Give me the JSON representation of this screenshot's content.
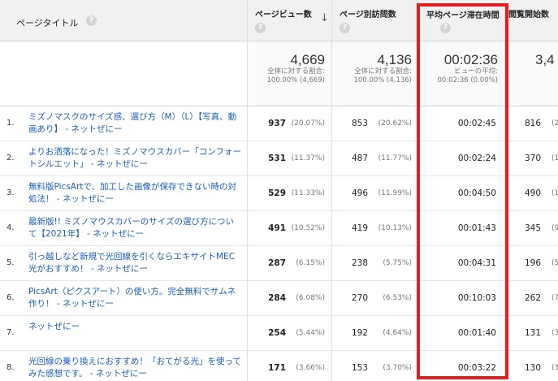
{
  "columns": {
    "title": "ページタイトル",
    "pageviews": "ページビュー数",
    "unique_pageviews": "ページ別訪問数",
    "avg_time": "平均ページ滞在時間",
    "entrances": "閲覧開始数",
    "help_glyph": "?",
    "sort_glyph": "↓"
  },
  "totals": {
    "pageviews": "4,669",
    "pageviews_sub": "全体に対する割合: 100.00% (4,669)",
    "unique_pageviews": "4,136",
    "unique_pageviews_sub": "全体に対する割合: 100.00% (4,136)",
    "avg_time": "00:02:36",
    "avg_time_sub": "ビューの平均: 00:02:36 (0.00%)",
    "entrances": "3,4"
  },
  "rows": [
    {
      "num": "1.",
      "title": "ミズノマスクのサイズ感、選び方（M）（L）【写真、動画あり】 - ネットぜにー",
      "pv": "937",
      "pv_pct": "(20.07%)",
      "upv": "853",
      "upv_pct": "(20.62%)",
      "avg": "00:02:45",
      "ent": "816",
      "ent_pct": "(23"
    },
    {
      "num": "2.",
      "title": "よりお洒落になった！ミズノマウスカバー「コンフォートシルエット」 - ネットぜにー",
      "pv": "531",
      "pv_pct": "(11.37%)",
      "upv": "487",
      "upv_pct": "(11.77%)",
      "avg": "00:02:24",
      "ent": "370",
      "ent_pct": "(10"
    },
    {
      "num": "3.",
      "title": "無料版PicsArtで、加工した画像が保存できない時の対処法！ - ネットぜにー",
      "pv": "529",
      "pv_pct": "(11.33%)",
      "upv": "496",
      "upv_pct": "(11.99%)",
      "avg": "00:04:50",
      "ent": "490",
      "ent_pct": "(14"
    },
    {
      "num": "4.",
      "title": "最新版!! ミズノマウスカバーのサイズの選び方について【2021年】 - ネットぜにー",
      "pv": "491",
      "pv_pct": "(10.52%)",
      "upv": "419",
      "upv_pct": "(10.13%)",
      "avg": "00:01:43",
      "ent": "345",
      "ent_pct": "(9"
    },
    {
      "num": "5.",
      "title": "引っ越しなど新規で光回線を引くならエキサイトMEC光がおすすめ！ - ネットぜにー",
      "pv": "287",
      "pv_pct": "(6.15%)",
      "upv": "238",
      "upv_pct": "(5.75%)",
      "avg": "00:04:31",
      "ent": "196",
      "ent_pct": "(5"
    },
    {
      "num": "6.",
      "title": "PicsArt（ピクスアート）の使い方。完全無料でサムネ作り！ - ネットぜにー",
      "pv": "284",
      "pv_pct": "(6.08%)",
      "upv": "270",
      "upv_pct": "(6.53%)",
      "avg": "00:10:03",
      "ent": "262",
      "ent_pct": "(7"
    },
    {
      "num": "7.",
      "title": "ネットぜにー",
      "pv": "254",
      "pv_pct": "(5.44%)",
      "upv": "192",
      "upv_pct": "(4.64%)",
      "avg": "00:01:40",
      "ent": "131",
      "ent_pct": "(3"
    },
    {
      "num": "8.",
      "title": "光回線の乗り換えにおすすめ！「おてがる光」を使ってみた感想です。 - ネットぜにー",
      "pv": "171",
      "pv_pct": "(3.66%)",
      "upv": "153",
      "upv_pct": "(3.70%)",
      "avg": "00:03:22",
      "ent": "130",
      "ent_pct": "(3"
    }
  ],
  "colors": {
    "highlight": "#e02020",
    "link": "#1a5fbf",
    "header_bg": "#f1f1f1"
  }
}
